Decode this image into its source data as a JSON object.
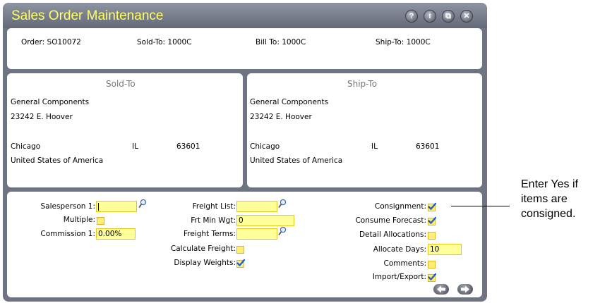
{
  "window": {
    "title": "Sales Order Maintenance"
  },
  "titlebar_buttons": [
    {
      "name": "help-button",
      "glyph": "?"
    },
    {
      "name": "info-button",
      "glyph": "i"
    },
    {
      "name": "restore-button",
      "glyph": "⧉"
    },
    {
      "name": "close-button",
      "glyph": "✕"
    }
  ],
  "header": {
    "order": "Order: SO10072",
    "sold_to": "Sold-To: 1000C",
    "bill_to": "Bill To: 1000C",
    "ship_to": "Ship-To: 1000C"
  },
  "sold_to": {
    "title": "Sold-To",
    "name": "General Components",
    "street": "23242 E. Hoover",
    "city": "Chicago",
    "state": "IL",
    "zip": "63601",
    "country": "United States of America"
  },
  "ship_to": {
    "title": "Ship-To",
    "name": "General Components",
    "street": "23242 E. Hoover",
    "city": "Chicago",
    "state": "IL",
    "zip": "63601",
    "country": "United States of America"
  },
  "form": {
    "salesperson_label": "Salesperson 1:",
    "salesperson_value": "",
    "multiple_label": "Multiple:",
    "commission_label": "Commission 1:",
    "commission_value": "0.00%",
    "freight_list_label": "Freight List:",
    "freight_list_value": "",
    "frt_min_wgt_label": "Frt Min Wgt:",
    "frt_min_wgt_value": "0",
    "freight_terms_label": "Freight Terms:",
    "freight_terms_value": "",
    "calc_freight_label": "Calculate Freight:",
    "display_weights_label": "Display Weights:",
    "consignment_label": "Consignment:",
    "consume_forecast_label": "Consume Forecast:",
    "detail_alloc_label": "Detail Allocations:",
    "allocate_days_label": "Allocate Days:",
    "allocate_days_value": "10",
    "comments_label": "Comments:",
    "import_export_label": "Import/Export:"
  },
  "checkboxes": {
    "multiple": false,
    "calculate_freight": false,
    "display_weights": true,
    "consignment": true,
    "consume_forecast": true,
    "detail_allocations": false,
    "comments": false,
    "import_export": true
  },
  "callout": {
    "text": "Enter Yes if items are consigned."
  },
  "colors": {
    "title": "#ffff66",
    "field_bg": "#ffff99",
    "frame": "#6f7483",
    "check": "#1f5fcf"
  }
}
